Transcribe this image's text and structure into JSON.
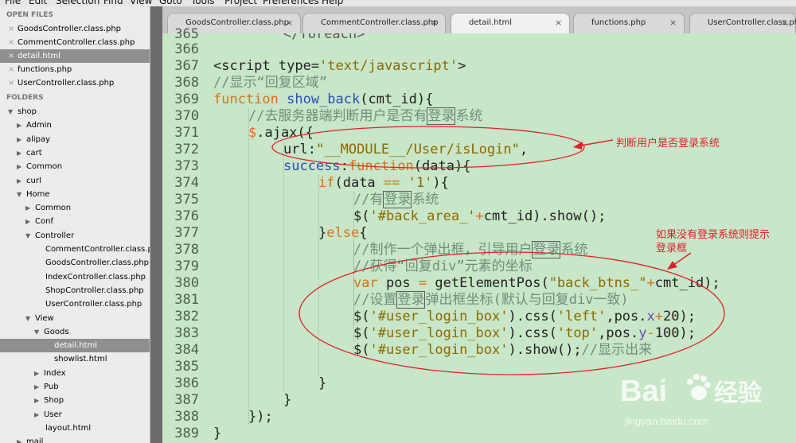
{
  "menu": [
    "File",
    "Edit",
    "Selection",
    "Find",
    "View",
    "Goto",
    "Tools",
    "Project",
    "Preferences",
    "Help"
  ],
  "sidebar": {
    "open_files_header": "OPEN FILES",
    "open_files": [
      {
        "label": "GoodsController.class.php",
        "selected": false
      },
      {
        "label": "CommentController.class.php",
        "selected": false
      },
      {
        "label": "detail.html",
        "selected": true
      },
      {
        "label": "functions.php",
        "selected": false
      },
      {
        "label": "UserController.class.php",
        "selected": false
      }
    ],
    "folders_header": "FOLDERS",
    "tree": [
      {
        "label": "shop",
        "depth": 0,
        "arrow": "open"
      },
      {
        "label": "Admin",
        "depth": 1,
        "arrow": "closed"
      },
      {
        "label": "alipay",
        "depth": 1,
        "arrow": "closed"
      },
      {
        "label": "cart",
        "depth": 1,
        "arrow": "closed"
      },
      {
        "label": "Common",
        "depth": 1,
        "arrow": "closed"
      },
      {
        "label": "curl",
        "depth": 1,
        "arrow": "closed"
      },
      {
        "label": "Home",
        "depth": 1,
        "arrow": "open"
      },
      {
        "label": "Common",
        "depth": 2,
        "arrow": "closed"
      },
      {
        "label": "Conf",
        "depth": 2,
        "arrow": "closed"
      },
      {
        "label": "Controller",
        "depth": 2,
        "arrow": "open"
      },
      {
        "label": "CommentController.class.php",
        "depth": 3,
        "arrow": ""
      },
      {
        "label": "GoodsController.class.php",
        "depth": 3,
        "arrow": ""
      },
      {
        "label": "IndexController.class.php",
        "depth": 3,
        "arrow": ""
      },
      {
        "label": "ShopController.class.php",
        "depth": 3,
        "arrow": ""
      },
      {
        "label": "UserController.class.php",
        "depth": 3,
        "arrow": ""
      },
      {
        "label": "View",
        "depth": 2,
        "arrow": "open"
      },
      {
        "label": "Goods",
        "depth": 3,
        "arrow": "open"
      },
      {
        "label": "detail.html",
        "depth": 4,
        "arrow": "",
        "selected": true
      },
      {
        "label": "showlist.html",
        "depth": 4,
        "arrow": ""
      },
      {
        "label": "Index",
        "depth": 3,
        "arrow": "closed"
      },
      {
        "label": "Pub",
        "depth": 3,
        "arrow": "closed"
      },
      {
        "label": "Shop",
        "depth": 3,
        "arrow": "closed"
      },
      {
        "label": "User",
        "depth": 3,
        "arrow": "closed"
      },
      {
        "label": "layout.html",
        "depth": 3,
        "arrow": ""
      },
      {
        "label": "mail",
        "depth": 1,
        "arrow": "closed"
      }
    ]
  },
  "tabs": [
    {
      "label": "GoodsController.class.php",
      "active": false
    },
    {
      "label": "CommentController.class.php",
      "active": false
    },
    {
      "label": "detail.html",
      "active": true
    },
    {
      "label": "functions.php",
      "active": false
    },
    {
      "label": "UserController.class.php",
      "active": false
    }
  ],
  "tab_close_glyph": "×",
  "editor": {
    "lines": [
      {
        "n": "366",
        "indent": 0,
        "tokens": []
      },
      {
        "n": "367",
        "indent": 0,
        "tokens": [
          {
            "t": "<script type=",
            "c": "p"
          },
          {
            "t": "'text/javascript'",
            "c": "s"
          },
          {
            "t": ">",
            "c": "p"
          }
        ]
      },
      {
        "n": "368",
        "indent": 0,
        "tokens": [
          {
            "t": "//显示“回复区域”",
            "c": "c"
          }
        ]
      },
      {
        "n": "369",
        "indent": 0,
        "tokens": [
          {
            "t": "function ",
            "c": "k"
          },
          {
            "t": "show_back",
            "c": "f"
          },
          {
            "t": "(cmt_id){",
            "c": "p"
          }
        ]
      },
      {
        "n": "370",
        "indent": 1,
        "tokens": [
          {
            "t": "//去服务器端判断用户是否有",
            "c": "c"
          },
          {
            "t": "登录",
            "c": "c",
            "box": true
          },
          {
            "t": "系统",
            "c": "c"
          }
        ]
      },
      {
        "n": "371",
        "indent": 1,
        "tokens": [
          {
            "t": "$",
            "c": "k"
          },
          {
            "t": ".ajax({",
            "c": "p"
          }
        ]
      },
      {
        "n": "372",
        "indent": 2,
        "tokens": [
          {
            "t": "url",
            "c": "p"
          },
          {
            "t": ":",
            "c": "p"
          },
          {
            "t": "\"__MODULE__/User/isLogin\"",
            "c": "s"
          },
          {
            "t": ",",
            "c": "p"
          }
        ]
      },
      {
        "n": "373",
        "indent": 2,
        "tokens": [
          {
            "t": "success",
            "c": "f"
          },
          {
            "t": ":",
            "c": "p"
          },
          {
            "t": "function",
            "c": "k"
          },
          {
            "t": "(data){",
            "c": "p"
          }
        ]
      },
      {
        "n": "374",
        "indent": 3,
        "tokens": [
          {
            "t": "if",
            "c": "k"
          },
          {
            "t": "(data ",
            "c": "p"
          },
          {
            "t": "==",
            "c": "k"
          },
          {
            "t": " ",
            "c": "p"
          },
          {
            "t": "'1'",
            "c": "s"
          },
          {
            "t": "){",
            "c": "p"
          }
        ]
      },
      {
        "n": "375",
        "indent": 4,
        "tokens": [
          {
            "t": "//有",
            "c": "c"
          },
          {
            "t": "登录",
            "c": "c",
            "box": true
          },
          {
            "t": "系统",
            "c": "c"
          }
        ]
      },
      {
        "n": "376",
        "indent": 4,
        "tokens": [
          {
            "t": "$(",
            "c": "p"
          },
          {
            "t": "'#back_area_'",
            "c": "s"
          },
          {
            "t": "+",
            "c": "k"
          },
          {
            "t": "cmt_id).show();",
            "c": "p"
          }
        ]
      },
      {
        "n": "377",
        "indent": 3,
        "tokens": [
          {
            "t": "}",
            "c": "p"
          },
          {
            "t": "else",
            "c": "k"
          },
          {
            "t": "{",
            "c": "p"
          }
        ]
      },
      {
        "n": "378",
        "indent": 4,
        "tokens": [
          {
            "t": "//制作一个弹出框，引导用户",
            "c": "c"
          },
          {
            "t": "登录",
            "c": "c",
            "box": true
          },
          {
            "t": "系统",
            "c": "c"
          }
        ]
      },
      {
        "n": "379",
        "indent": 4,
        "tokens": [
          {
            "t": "//获得“回复div”元素的坐标",
            "c": "c"
          }
        ]
      },
      {
        "n": "380",
        "indent": 4,
        "tokens": [
          {
            "t": "var ",
            "c": "k"
          },
          {
            "t": "pos ",
            "c": "p"
          },
          {
            "t": "=",
            "c": "k"
          },
          {
            "t": " getElementPos(",
            "c": "p"
          },
          {
            "t": "\"back_btns_\"",
            "c": "s"
          },
          {
            "t": "+",
            "c": "k"
          },
          {
            "t": "cmt_id);",
            "c": "p"
          }
        ]
      },
      {
        "n": "381",
        "indent": 4,
        "tokens": [
          {
            "t": "//设置",
            "c": "c"
          },
          {
            "t": "登录",
            "c": "c",
            "box": true
          },
          {
            "t": "弹出框坐标(默认与回复div一致)",
            "c": "c"
          }
        ]
      },
      {
        "n": "382",
        "indent": 4,
        "tokens": [
          {
            "t": "$(",
            "c": "p"
          },
          {
            "t": "'#user_login_box'",
            "c": "s"
          },
          {
            "t": ").css(",
            "c": "p"
          },
          {
            "t": "'left'",
            "c": "s"
          },
          {
            "t": ",pos.",
            "c": "p"
          },
          {
            "t": "x",
            "c": "b"
          },
          {
            "t": "+",
            "c": "k"
          },
          {
            "t": "20);",
            "c": "p"
          }
        ]
      },
      {
        "n": "383",
        "indent": 4,
        "tokens": [
          {
            "t": "$(",
            "c": "p"
          },
          {
            "t": "'#user_login_box'",
            "c": "s"
          },
          {
            "t": ").css(",
            "c": "p"
          },
          {
            "t": "'top'",
            "c": "s"
          },
          {
            "t": ",pos.",
            "c": "p"
          },
          {
            "t": "y",
            "c": "b"
          },
          {
            "t": "-",
            "c": "k"
          },
          {
            "t": "100);",
            "c": "p"
          }
        ]
      },
      {
        "n": "384",
        "indent": 4,
        "tokens": [
          {
            "t": "$(",
            "c": "p"
          },
          {
            "t": "'#user_login_box'",
            "c": "s"
          },
          {
            "t": ").show();",
            "c": "p"
          },
          {
            "t": "//显示出来",
            "c": "c"
          }
        ]
      },
      {
        "n": "385",
        "indent": 0,
        "tokens": []
      },
      {
        "n": "386",
        "indent": 3,
        "tokens": [
          {
            "t": "}",
            "c": "p"
          }
        ]
      },
      {
        "n": "387",
        "indent": 2,
        "tokens": [
          {
            "t": "}",
            "c": "p"
          }
        ]
      },
      {
        "n": "388",
        "indent": 1,
        "tokens": [
          {
            "t": "});",
            "c": "p"
          }
        ]
      },
      {
        "n": "389",
        "indent": 0,
        "tokens": [
          {
            "t": "}",
            "c": "p"
          }
        ]
      }
    ],
    "partial_top_line": "</foreach>"
  },
  "annotations": {
    "login_check": "判断用户是否登录系统",
    "popup_line1": "如果没有登录系统则提示",
    "popup_line2": "登录框",
    "annotation_color": "#e0202a"
  },
  "watermark": {
    "brand_prefix": "Bai",
    "brand_suffix": "经验",
    "url": "jingyan.baidu.com"
  },
  "colors": {
    "editor_bg": "#c8e6c8",
    "keyword": "#d4731c",
    "comment": "#6e8f7b",
    "string": "#8a6a00",
    "func": "#2a4fb0"
  }
}
